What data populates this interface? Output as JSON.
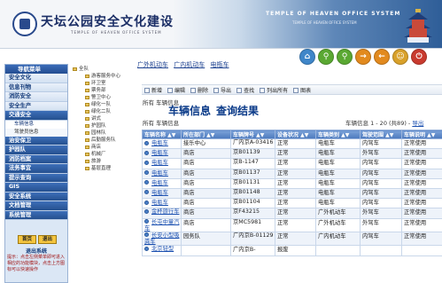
{
  "header": {
    "title": "天坛公园安全文化建设",
    "subtitle": "TEMPLE OF HEAVEN OFFICE SYSTEM",
    "en_title": "TEMPLE OF HEAVEN OFFICE SYSTEM",
    "en_subtitle": "TEMPLE OF HEAVEN OFFICE SYSTEM"
  },
  "nav": [
    "广外机动车",
    "广内机动车",
    "电瓶车"
  ],
  "top_icons": [
    {
      "name": "home-icon",
      "glyph": "⌂",
      "color": "#3f86c9"
    },
    {
      "name": "search-icon",
      "glyph": "⚲",
      "color": "#5aa832"
    },
    {
      "name": "zoom-icon",
      "glyph": "⚲",
      "color": "#5aa832"
    },
    {
      "name": "forward-icon",
      "glyph": "→",
      "color": "#e28a1e"
    },
    {
      "name": "back-icon",
      "glyph": "←",
      "color": "#e28a1e"
    },
    {
      "name": "user-icon",
      "glyph": "☺",
      "color": "#d9a12a"
    },
    {
      "name": "exit-icon",
      "glyph": "⏻",
      "color": "#c93a2e"
    }
  ],
  "sidebar": {
    "header": "导航菜单",
    "items": [
      "安全文化",
      "信息刊物",
      "消防安全",
      "安全生产",
      "交通安全"
    ],
    "subs": [
      "车辆信息",
      "驾驶员信息"
    ],
    "items2": [
      "治安保卫",
      "护园队",
      "消防档案",
      "法务事宜",
      "提示查询",
      "GIS",
      "安全系统",
      "文档管理",
      "系统管理"
    ],
    "buttons": [
      "首页",
      "退出"
    ],
    "bottom_title": "退出系统",
    "bottom_text": "提示：点击左侧菜单即可进入相应的功能模块，点击上方图标可以快速操作"
  },
  "tree": {
    "root": "全队",
    "children": [
      "游客服务中心",
      "环卫室",
      "票务部",
      "警卫中心",
      "绿化一队",
      "绿化二队",
      "讲式",
      "护园队",
      "园林队",
      "后勤服务队",
      "商店",
      "机械厂",
      "旅游",
      "基层直理"
    ]
  },
  "toolbar": [
    "新增",
    "编辑",
    "删除",
    "导出",
    "查找",
    "列出所有",
    "图表"
  ],
  "crumb": "所有  车辆信息",
  "page_title": [
    "车辆信息",
    "查询结果"
  ],
  "section": "所有  车辆信息",
  "pager": {
    "text": "车辆信息 1 - 20 (共89) - ",
    "link": "导出"
  },
  "table": {
    "columns": [
      "车辆名称 ▲▼",
      "所在部门 ▲▼",
      "车辆牌号 ▲▼",
      "设备状况 ▲▼",
      "车辆类别 ▲▼",
      "驾驶范围 ▲▼",
      "车辆说明 ▲▼"
    ],
    "rows": [
      [
        "电瓶车",
        "接乐中心",
        "广内京A-03416",
        "正常",
        "电瓶车",
        "内驾车",
        "正常使用"
      ],
      [
        "电瓶车",
        "商店",
        "京B01139",
        "正常",
        "电瓶车",
        "外驾车",
        "正常使用"
      ],
      [
        "电瓶车",
        "商店",
        "京B-1147",
        "正常",
        "电瓶车",
        "内驾车",
        "正常使用"
      ],
      [
        "电瓶车",
        "商店",
        "京B01137",
        "正常",
        "电瓶车",
        "内驾车",
        "正常使用"
      ],
      [
        "电瓶车",
        "商店",
        "京B01131",
        "正常",
        "电瓶车",
        "内驾车",
        "正常使用"
      ],
      [
        "电瓶车",
        "商店",
        "京B01148",
        "正常",
        "电瓶车",
        "内驾车",
        "正常使用"
      ],
      [
        "电瓶车",
        "商店",
        "京B01104",
        "正常",
        "电瓶车",
        "内驾车",
        "正常使用"
      ],
      [
        "金杯旅行车",
        "商店",
        "京F43215",
        "正常",
        "广外机动车",
        "外驾车",
        "正常使用"
      ],
      [
        "长屯中童汽车",
        "商店",
        "京MC5981",
        "正常",
        "广外机动车",
        "外驾车",
        "正常使用"
      ],
      [
        "长安小型吸粪车",
        "园务队",
        "广内京B-01129",
        "正常",
        "广内机动车",
        "内驾车",
        "正常使用"
      ],
      [
        "北京轻型",
        "",
        "广内京B-",
        "报废",
        "",
        "",
        ""
      ]
    ]
  }
}
